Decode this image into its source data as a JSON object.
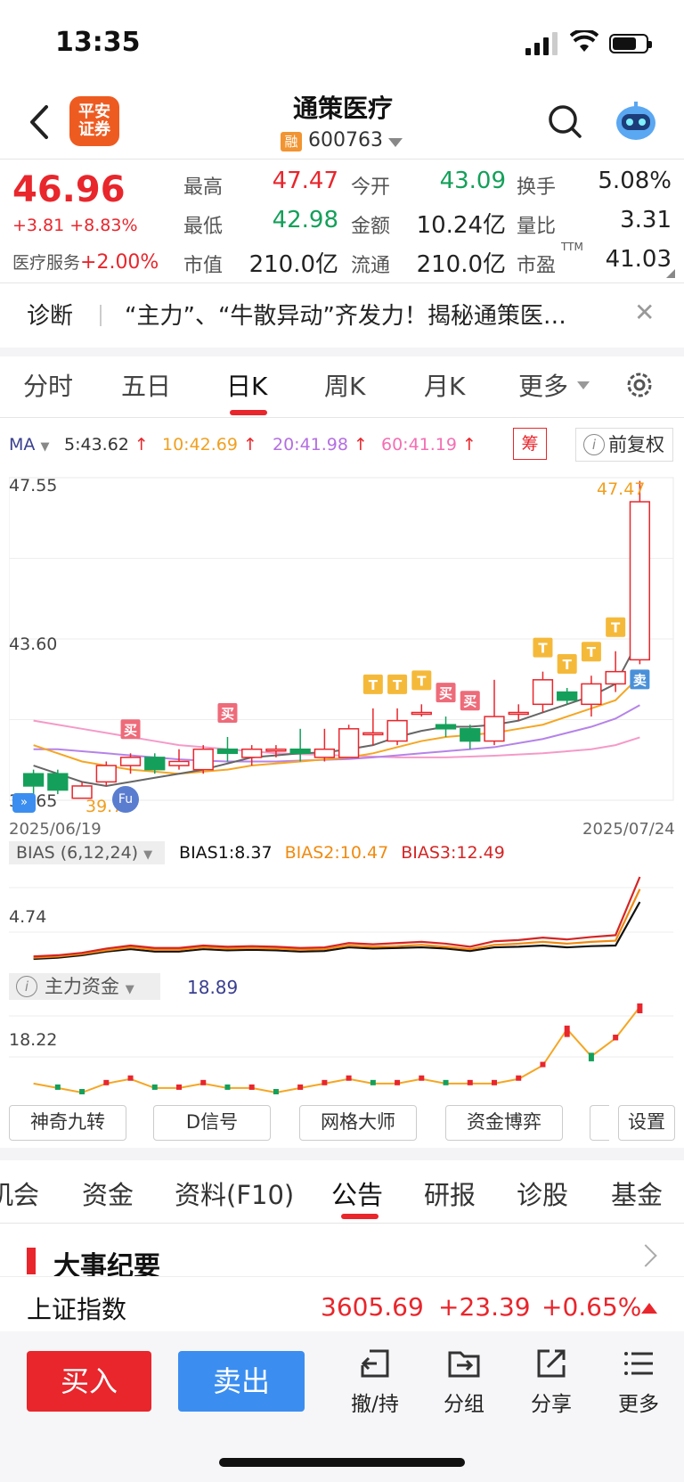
{
  "status_bar": {
    "time": "13:35"
  },
  "header": {
    "broker_logo": "平安\n证券",
    "broker_logo_line1": "平安",
    "broker_logo_line2": "证券",
    "stock_name": "通策医疗",
    "margin_badge": "融",
    "stock_code": "600763"
  },
  "quote": {
    "price": "46.96",
    "change": "+3.81 +8.83%",
    "sector_label": "医疗服务",
    "sector_change": "+2.00%",
    "labels": {
      "high": "最高",
      "open": "今开",
      "turnover": "换手",
      "low": "最低",
      "amount": "金额",
      "vol_ratio": "量比",
      "mkt_cap": "市值",
      "float_cap": "流通",
      "pe": "市盈"
    },
    "pe_suffix": "TTM",
    "high": "47.47",
    "open": "43.09",
    "turnover": "5.08%",
    "low": "42.98",
    "amount": "10.24亿",
    "vol_ratio": "3.31",
    "mkt_cap": "210.0亿",
    "float_cap": "210.0亿",
    "pe": "41.03"
  },
  "diagnosis": {
    "label": "诊断",
    "text": "“主力”、“牛散异动”齐发力！揭秘通策医…"
  },
  "chart_tabs": [
    "分时",
    "五日",
    "日K",
    "周K",
    "月K",
    "更多"
  ],
  "ma_row": {
    "ma_label": "MA",
    "ma5": "5:43.62",
    "ma10": "10:42.69",
    "ma20": "20:41.98",
    "ma60": "60:41.19",
    "chou_label": "筹",
    "fuquan_label": "前复权"
  },
  "kline": {
    "y_top_label": "47.55",
    "y_mid_label": "43.60",
    "y_bottom_label": "39.65",
    "date_start": "2025/06/19",
    "date_end": "2025/07/24",
    "high_marker": "47.47",
    "low_marker": "39.70",
    "buy_tag": "买",
    "sell_tag": "卖",
    "t_tag": "T",
    "fu_tag": "Fu"
  },
  "bias": {
    "tag": "BIAS (6,12,24)",
    "bias1": "BIAS1:8.37",
    "bias2": "BIAS2:10.47",
    "bias3": "BIAS3:12.49",
    "y_label": "4.74"
  },
  "main_fund": {
    "tag": "主力资金",
    "value": "18.89",
    "y_label": "18.22"
  },
  "tools": [
    "神奇九转",
    "D信号",
    "网格大师",
    "资金博弈",
    "设置"
  ],
  "bottom_tabs": [
    "机会",
    "资金",
    "资料(F10)",
    "公告",
    "研报",
    "诊股",
    "基金"
  ],
  "section_title": "大事纪要",
  "index": {
    "name": "上证指数",
    "value": "3605.69",
    "change": "+23.39",
    "pct": "+0.65%"
  },
  "actions": {
    "buy": "买入",
    "sell": "卖出",
    "withdraw": "撤/持",
    "group": "分组",
    "share": "分享",
    "more": "更多"
  },
  "colors": {
    "up": "#e8262c",
    "down": "#14a05a",
    "accent_blue": "#3b8ef0"
  },
  "chart_data": {
    "type": "candlestick",
    "y_range": [
      39.65,
      47.55
    ],
    "x_range": [
      "2025/06/19",
      "2025/07/24"
    ],
    "candles": [
      {
        "o": 40.3,
        "c": 40.0,
        "h": 40.4,
        "l": 39.8
      },
      {
        "o": 40.3,
        "c": 39.9,
        "h": 40.4,
        "l": 39.8
      },
      {
        "o": 39.7,
        "c": 40.0,
        "h": 40.1,
        "l": 39.7
      },
      {
        "o": 40.1,
        "c": 40.5,
        "h": 40.6,
        "l": 40.0
      },
      {
        "o": 40.5,
        "c": 40.7,
        "h": 40.8,
        "l": 40.3
      },
      {
        "o": 40.7,
        "c": 40.4,
        "h": 40.8,
        "l": 40.3
      },
      {
        "o": 40.5,
        "c": 40.6,
        "h": 40.9,
        "l": 40.4
      },
      {
        "o": 40.4,
        "c": 40.9,
        "h": 41.0,
        "l": 40.3
      },
      {
        "o": 40.9,
        "c": 40.8,
        "h": 41.2,
        "l": 40.6
      },
      {
        "o": 40.7,
        "c": 40.9,
        "h": 41.0,
        "l": 40.5
      },
      {
        "o": 40.9,
        "c": 40.9,
        "h": 41.0,
        "l": 40.7
      },
      {
        "o": 40.9,
        "c": 40.8,
        "h": 41.4,
        "l": 40.6
      },
      {
        "o": 40.7,
        "c": 40.9,
        "h": 41.4,
        "l": 40.6
      },
      {
        "o": 40.7,
        "c": 41.4,
        "h": 41.5,
        "l": 40.7
      },
      {
        "o": 41.3,
        "c": 41.3,
        "h": 41.9,
        "l": 41.0
      },
      {
        "o": 41.1,
        "c": 41.6,
        "h": 41.9,
        "l": 41.0
      },
      {
        "o": 41.8,
        "c": 41.8,
        "h": 42.0,
        "l": 41.7
      },
      {
        "o": 41.5,
        "c": 41.4,
        "h": 41.7,
        "l": 41.2
      },
      {
        "o": 41.4,
        "c": 41.1,
        "h": 41.5,
        "l": 40.9
      },
      {
        "o": 41.1,
        "c": 41.7,
        "h": 42.6,
        "l": 41.0
      },
      {
        "o": 41.8,
        "c": 41.8,
        "h": 42.0,
        "l": 41.6
      },
      {
        "o": 42.0,
        "c": 42.6,
        "h": 42.8,
        "l": 41.8
      },
      {
        "o": 42.3,
        "c": 42.1,
        "h": 42.4,
        "l": 42.0
      },
      {
        "o": 42.0,
        "c": 42.5,
        "h": 42.7,
        "l": 41.7
      },
      {
        "o": 42.5,
        "c": 42.8,
        "h": 43.3,
        "l": 42.3
      },
      {
        "o": 43.09,
        "c": 46.96,
        "h": 47.47,
        "l": 42.98
      }
    ],
    "ma5": [
      40.5,
      40.3,
      40.1,
      40.0,
      40.1,
      40.2,
      40.3,
      40.4,
      40.55,
      40.7,
      40.75,
      40.8,
      40.82,
      40.9,
      41.0,
      41.2,
      41.35,
      41.45,
      41.45,
      41.5,
      41.6,
      41.8,
      42.0,
      42.2,
      42.5,
      43.62
    ],
    "ma10": [
      41.0,
      40.8,
      40.6,
      40.5,
      40.4,
      40.35,
      40.3,
      40.35,
      40.4,
      40.5,
      40.55,
      40.6,
      40.65,
      40.7,
      40.8,
      40.95,
      41.1,
      41.2,
      41.25,
      41.3,
      41.4,
      41.5,
      41.7,
      41.9,
      42.1,
      42.69
    ],
    "ma20": [
      40.9,
      40.9,
      40.85,
      40.8,
      40.75,
      40.7,
      40.65,
      40.62,
      40.6,
      40.6,
      40.6,
      40.62,
      40.64,
      40.66,
      40.7,
      40.75,
      40.8,
      40.85,
      40.9,
      40.95,
      41.05,
      41.15,
      41.3,
      41.45,
      41.65,
      41.98
    ],
    "ma60": [
      41.6,
      41.5,
      41.4,
      41.3,
      41.2,
      41.1,
      41.0,
      40.95,
      40.9,
      40.85,
      40.8,
      40.78,
      40.76,
      40.74,
      40.72,
      40.7,
      40.7,
      40.7,
      40.72,
      40.74,
      40.77,
      40.8,
      40.85,
      40.9,
      41.0,
      41.19
    ],
    "bias_series": [
      {
        "name": "BIAS1",
        "values": [
          -1,
          -0.8,
          -0.4,
          0.2,
          0.6,
          0.2,
          0.2,
          0.6,
          0.4,
          0.5,
          0.4,
          0.2,
          0.3,
          0.9,
          0.7,
          0.8,
          0.9,
          0.7,
          0.3,
          0.9,
          1.0,
          1.2,
          0.9,
          1.1,
          1.2,
          8.37
        ]
      },
      {
        "name": "BIAS2",
        "values": [
          -0.8,
          -0.6,
          -0.2,
          0.4,
          0.9,
          0.5,
          0.5,
          0.9,
          0.7,
          0.8,
          0.7,
          0.5,
          0.6,
          1.2,
          1.0,
          1.1,
          1.3,
          1.0,
          0.6,
          1.3,
          1.5,
          1.8,
          1.5,
          1.8,
          2.0,
          10.47
        ]
      },
      {
        "name": "BIAS3",
        "values": [
          -0.6,
          -0.4,
          0.0,
          0.7,
          1.2,
          0.8,
          0.8,
          1.2,
          1.0,
          1.1,
          1.0,
          0.8,
          0.9,
          1.6,
          1.4,
          1.6,
          1.8,
          1.5,
          1.0,
          1.9,
          2.1,
          2.5,
          2.2,
          2.6,
          2.9,
          12.49
        ]
      }
    ],
    "main_fund_series": [
      2,
      1,
      0,
      2,
      3,
      1,
      1,
      2,
      1,
      1,
      0,
      1,
      2,
      3,
      2,
      2,
      3,
      2,
      2,
      2,
      3,
      6,
      14,
      8,
      12,
      18.89
    ]
  }
}
